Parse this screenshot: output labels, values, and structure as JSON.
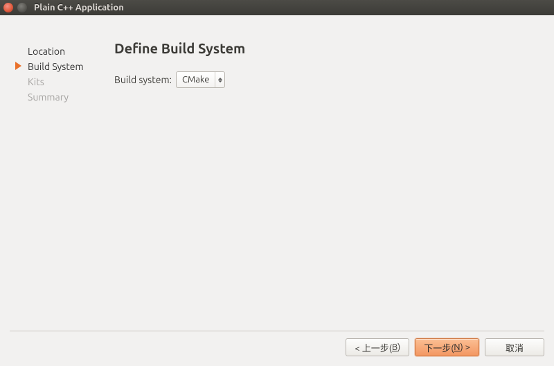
{
  "window": {
    "title": "Plain C++ Application"
  },
  "sidebar": {
    "steps": {
      "location": {
        "label": "Location"
      },
      "build_system": {
        "label": "Build System"
      },
      "kits": {
        "label": "Kits"
      },
      "summary": {
        "label": "Summary"
      }
    }
  },
  "main": {
    "heading": "Define Build System",
    "build_system_label": "Build system:",
    "build_system_value": "CMake"
  },
  "buttons": {
    "back_prefix": "< 上一步(",
    "back_key": "B",
    "back_suffix": ")",
    "next_prefix": "下一步(",
    "next_key": "N",
    "next_suffix": ") >",
    "cancel": "取消"
  }
}
